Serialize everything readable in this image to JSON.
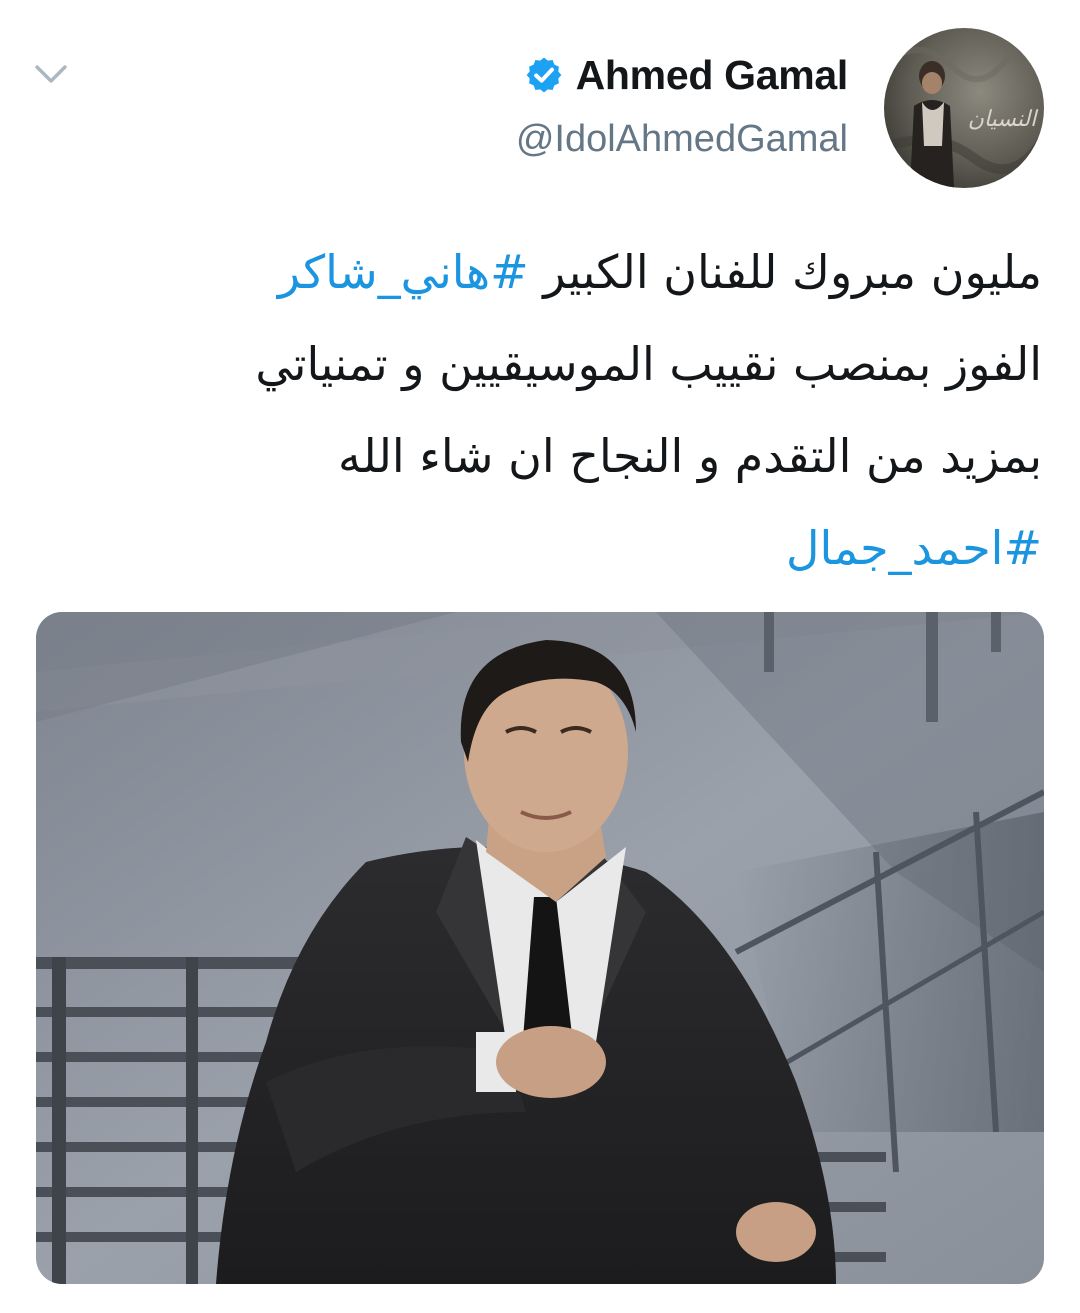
{
  "tweet": {
    "author": {
      "display_name": "Ahmed Gamal",
      "handle": "@IdolAhmedGamal",
      "verified": true
    },
    "text_lines": [
      {
        "parts": [
          {
            "text": "مليون مبروك للفنان الكبير ",
            "type": "text"
          },
          {
            "text": "#هاني_شاكر",
            "type": "hashtag"
          }
        ]
      },
      {
        "parts": [
          {
            "text": "الفوز بمنصب نقييب الموسيقيين و تمنياتي",
            "type": "text"
          }
        ]
      },
      {
        "parts": [
          {
            "text": "بمزيد من التقدم و النجاح ان شاء الله",
            "type": "text"
          }
        ]
      },
      {
        "parts": [
          {
            "text": "#احمد_جمال",
            "type": "hashtag"
          }
        ]
      }
    ],
    "avatar_overlay_text": "النسيان",
    "icons": {
      "more": "chevron-down-icon",
      "verified": "verified-badge-icon"
    },
    "colors": {
      "hashtag": "#1b95e0",
      "verified": "#1da1f2",
      "handle": "#657786",
      "caret": "#aab8c2"
    }
  }
}
